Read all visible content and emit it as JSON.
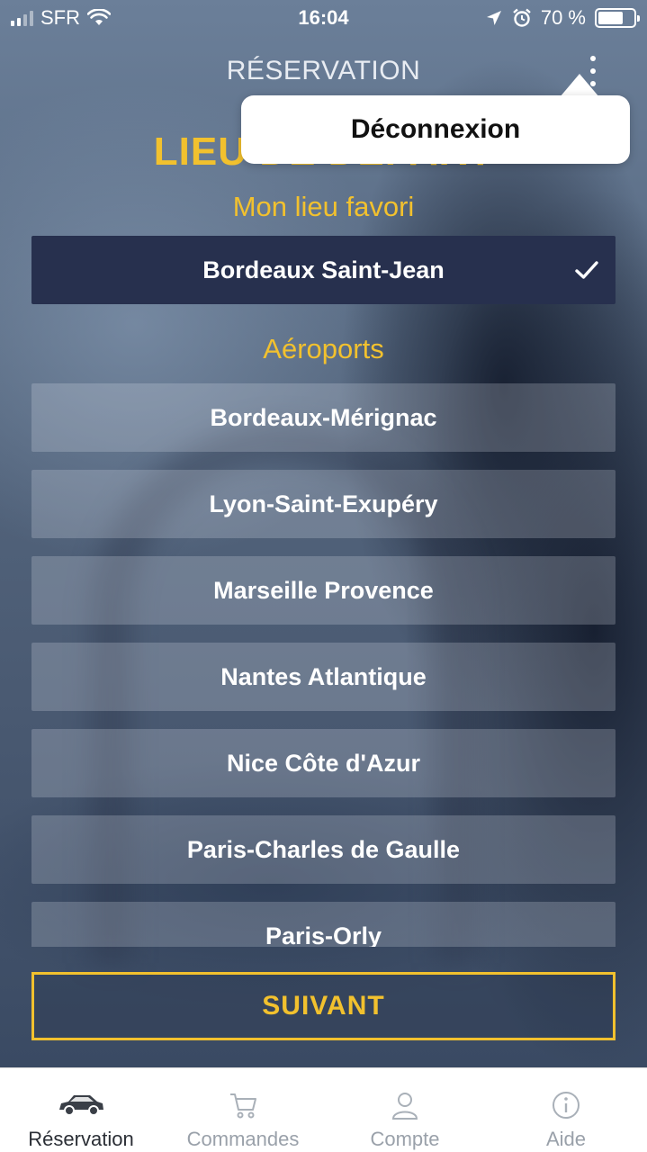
{
  "status_bar": {
    "carrier": "SFR",
    "time": "16:04",
    "battery": "70 %"
  },
  "header": {
    "title": "RÉSERVATION"
  },
  "menu": {
    "logout_label": "Déconnexion"
  },
  "main": {
    "section_title": "LIEU DE DÉPART",
    "favorite_heading": "Mon lieu favori",
    "favorite_item": "Bordeaux Saint-Jean",
    "airports_heading": "Aéroports",
    "airports": [
      "Bordeaux-Mérignac",
      "Lyon-Saint-Exupéry",
      "Marseille Provence",
      "Nantes Atlantique",
      "Nice Côte d'Azur",
      "Paris-Charles de Gaulle",
      "Paris-Orly"
    ],
    "next_label": "SUIVANT"
  },
  "tabbar": {
    "tabs": [
      {
        "label": "Réservation",
        "icon": "car-icon"
      },
      {
        "label": "Commandes",
        "icon": "cart-icon"
      },
      {
        "label": "Compte",
        "icon": "user-icon"
      },
      {
        "label": "Aide",
        "icon": "info-icon"
      }
    ]
  },
  "colors": {
    "accent": "#f2c12e",
    "selected_item": "#27304e"
  }
}
